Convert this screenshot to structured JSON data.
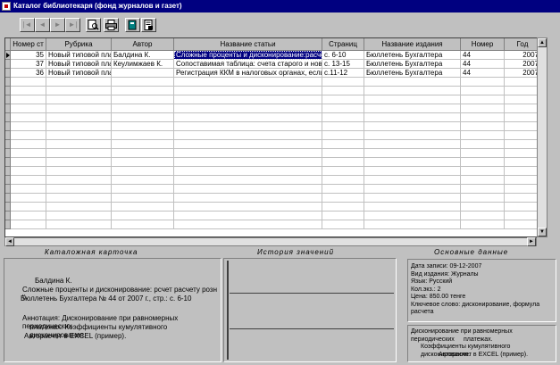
{
  "window": {
    "title": "Каталог библиотекаря (фонд журналов и газет)"
  },
  "toolbar": {
    "first": "|◄",
    "prev": "◄",
    "next": "►",
    "last": "►|"
  },
  "grid": {
    "columns": [
      "Номер ст",
      "Рубрика",
      "Автор",
      "Название статьи",
      "Страниц",
      "Название издания",
      "Номер",
      "Год"
    ],
    "rows": [
      [
        "35",
        "Новый типовой план",
        "Балдина К.",
        "Сложные проценты и дисконирование:расчет",
        "с. 6-10",
        "Бюллетень Бухгалтера",
        "44",
        "2007"
      ],
      [
        "37",
        "Новый типовой план",
        "Кеулимжаев К.",
        "Сопоставимая таблица: счета старого и нового",
        "с. 13-15",
        "Бюллетень Бухгалтера",
        "44",
        "2007"
      ],
      [
        "36",
        "Новый типовой план",
        "",
        "Регистрация ККМ в налоговых органах, если КК",
        "с.11-12",
        "Бюллетень Бухгалтера",
        "44",
        "2007"
      ]
    ]
  },
  "sections": {
    "catalog_card": "Каталожная карточка",
    "history": "История значений",
    "main_data": "Основные данные"
  },
  "card": {
    "author": "Балдина К.",
    "title_line": "Сложные проценты и дисконирование: рсчет расчету розн \\\\",
    "source_line": "Бюллетень Бухгалтера № 44 от 2007 г., стр.: с. 6-10",
    "annotation_1": "Аннотация: Дисконирование при равномерных периодических",
    "annotation_2": "платежах. Коэффициенты кумулятивного дисконирования.",
    "annotation_3": "Авторасчет в EXCEL (пример)."
  },
  "main_info": {
    "date": "Дата записи: 09-12-2007",
    "kind": "Вид издания: Журналы",
    "lang": "Язык: Русский",
    "copies": "Кол.экз.: 2",
    "price": "Цена: 850.00 тенге",
    "keywords_1": "Ключевое слово: дисконирование, формула",
    "keywords_2": "расчета"
  },
  "annotation_box": {
    "l1": "Дисконирование при равномерных периодических",
    "l2": "платежах.",
    "l3": "Коэффициенты кумулятивного дисконирования.",
    "l4": "Авторасчет в EXCEL (пример)."
  }
}
